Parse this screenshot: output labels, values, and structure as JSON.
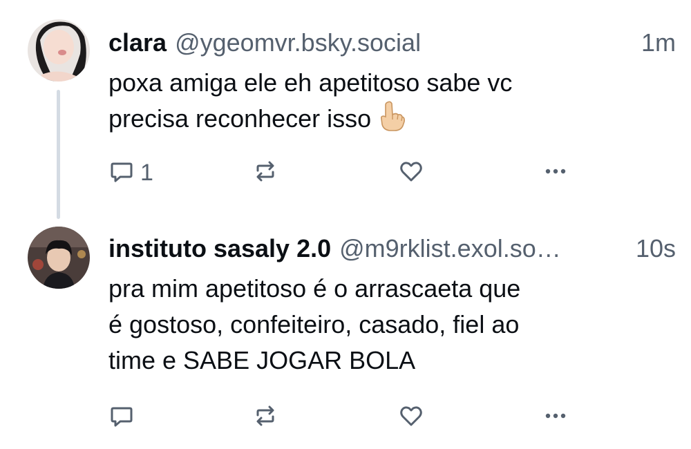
{
  "posts": [
    {
      "name": "clara",
      "handle": "@ygeomvr.bsky.social",
      "time": "1m",
      "text_line1": "poxa amiga ele eh apetitoso sabe vc",
      "text_line2": "precisa reconhecer isso",
      "emoji": "pointing-up-hand-emoji",
      "reply_count": "1"
    },
    {
      "name": "instituto sasaly 2.0",
      "handle": "@m9rklist.exol.so…",
      "time": "10s",
      "text_line1": "pra mim apetitoso é o arrascaeta que",
      "text_line2": "é gostoso, confeiteiro, casado, fiel ao",
      "text_line3": "time e SABE JOGAR BOLA",
      "reply_count": ""
    }
  ],
  "colors": {
    "text": "#0b0f14",
    "muted": "#55606e",
    "thread_line": "#d4dbe3",
    "background": "#ffffff"
  },
  "icons": [
    "reply-icon",
    "repost-icon",
    "like-icon",
    "more-icon"
  ]
}
